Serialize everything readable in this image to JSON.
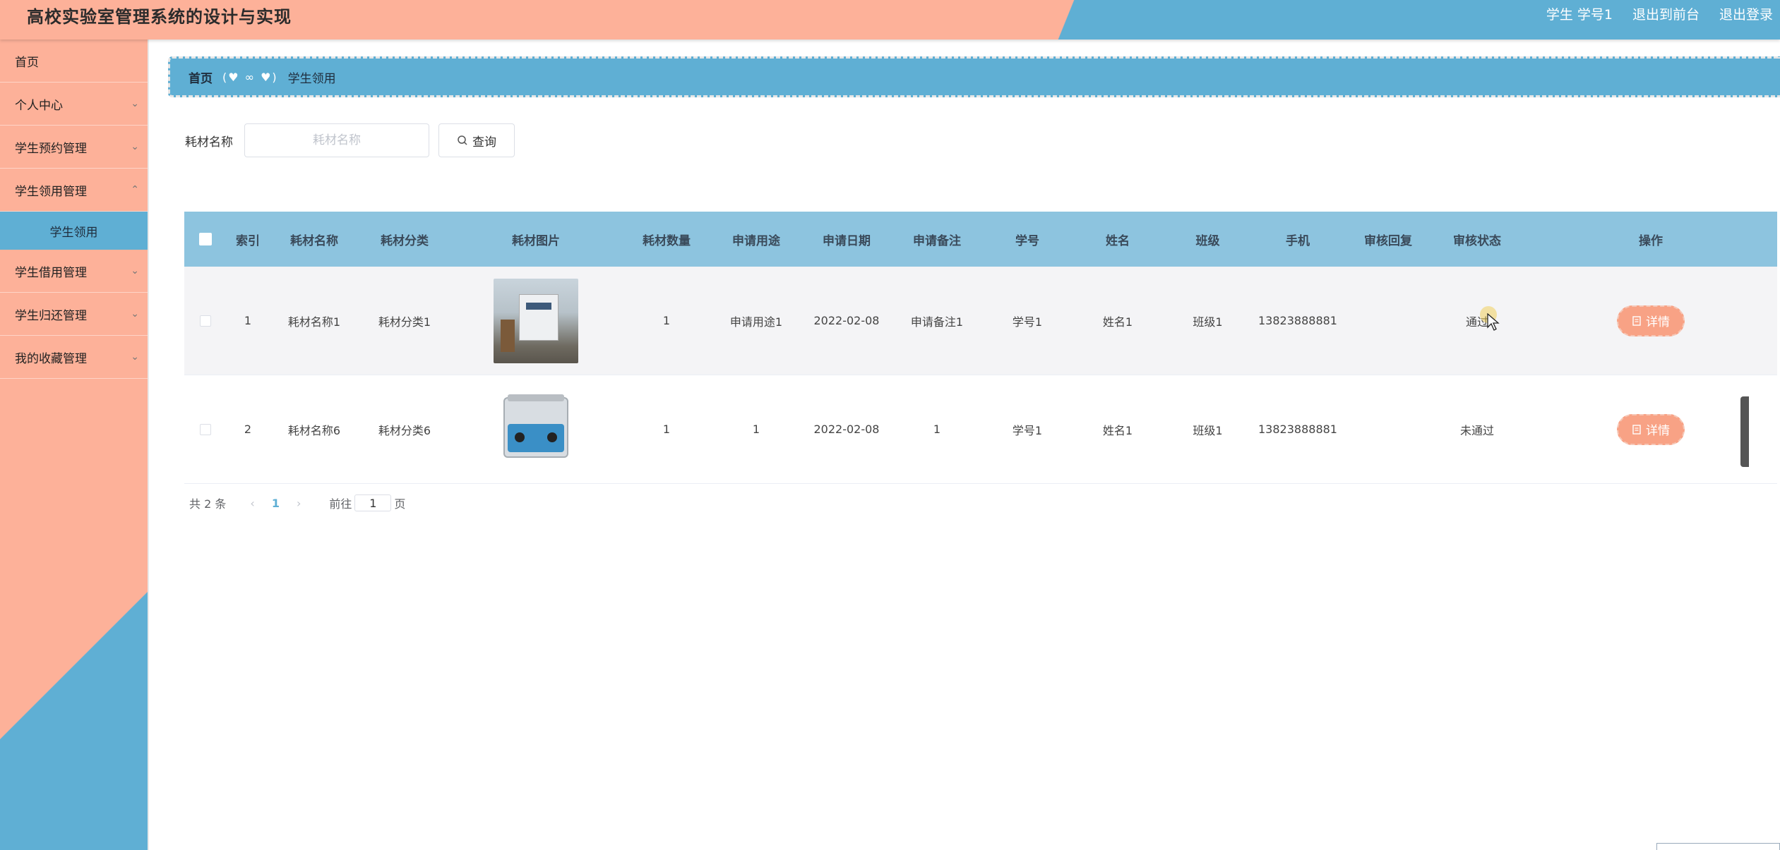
{
  "header": {
    "title": "高校实验室管理系统的设计与实现",
    "user_role": "学生",
    "user_id": "学号1",
    "to_front": "退出到前台",
    "logout": "退出登录"
  },
  "sidebar": {
    "items": [
      {
        "label": "首页"
      },
      {
        "label": "个人中心"
      },
      {
        "label": "学生预约管理"
      },
      {
        "label": "学生领用管理"
      },
      {
        "label": "学生领用"
      },
      {
        "label": "学生借用管理"
      },
      {
        "label": "学生归还管理"
      },
      {
        "label": "我的收藏管理"
      }
    ]
  },
  "breadcrumb": {
    "home": "首页",
    "current": "学生领用"
  },
  "search": {
    "label": "耗材名称",
    "placeholder": "耗材名称",
    "button": "查询"
  },
  "table": {
    "headers": [
      "索引",
      "耗材名称",
      "耗材分类",
      "耗材图片",
      "耗材数量",
      "申请用途",
      "申请日期",
      "申请备注",
      "学号",
      "姓名",
      "班级",
      "手机",
      "审核回复",
      "审核状态",
      "操作"
    ],
    "rows": [
      {
        "index": "1",
        "name": "耗材名称1",
        "category": "耗材分类1",
        "qty": "1",
        "use": "申请用途1",
        "date": "2022-02-08",
        "note": "申请备注1",
        "sno": "学号1",
        "sname": "姓名1",
        "cls": "班级1",
        "phone": "13823888881",
        "reply": "",
        "status": "通过",
        "op": "详情"
      },
      {
        "index": "2",
        "name": "耗材名称6",
        "category": "耗材分类6",
        "qty": "1",
        "use": "1",
        "date": "2022-02-08",
        "note": "1",
        "sno": "学号1",
        "sname": "姓名1",
        "cls": "班级1",
        "phone": "13823888881",
        "reply": "",
        "status": "未通过",
        "op": "详情"
      }
    ]
  },
  "pagination": {
    "total_prefix": "共",
    "total": "2",
    "total_suffix": "条",
    "current": "1",
    "goto_label": "前往",
    "goto_value": "1",
    "page_suffix": "页"
  },
  "colors": {
    "accent_orange": "#fdb199",
    "accent_blue": "#5fafd4",
    "header_row": "#8dc4df",
    "detail_button": "#f8a285"
  }
}
